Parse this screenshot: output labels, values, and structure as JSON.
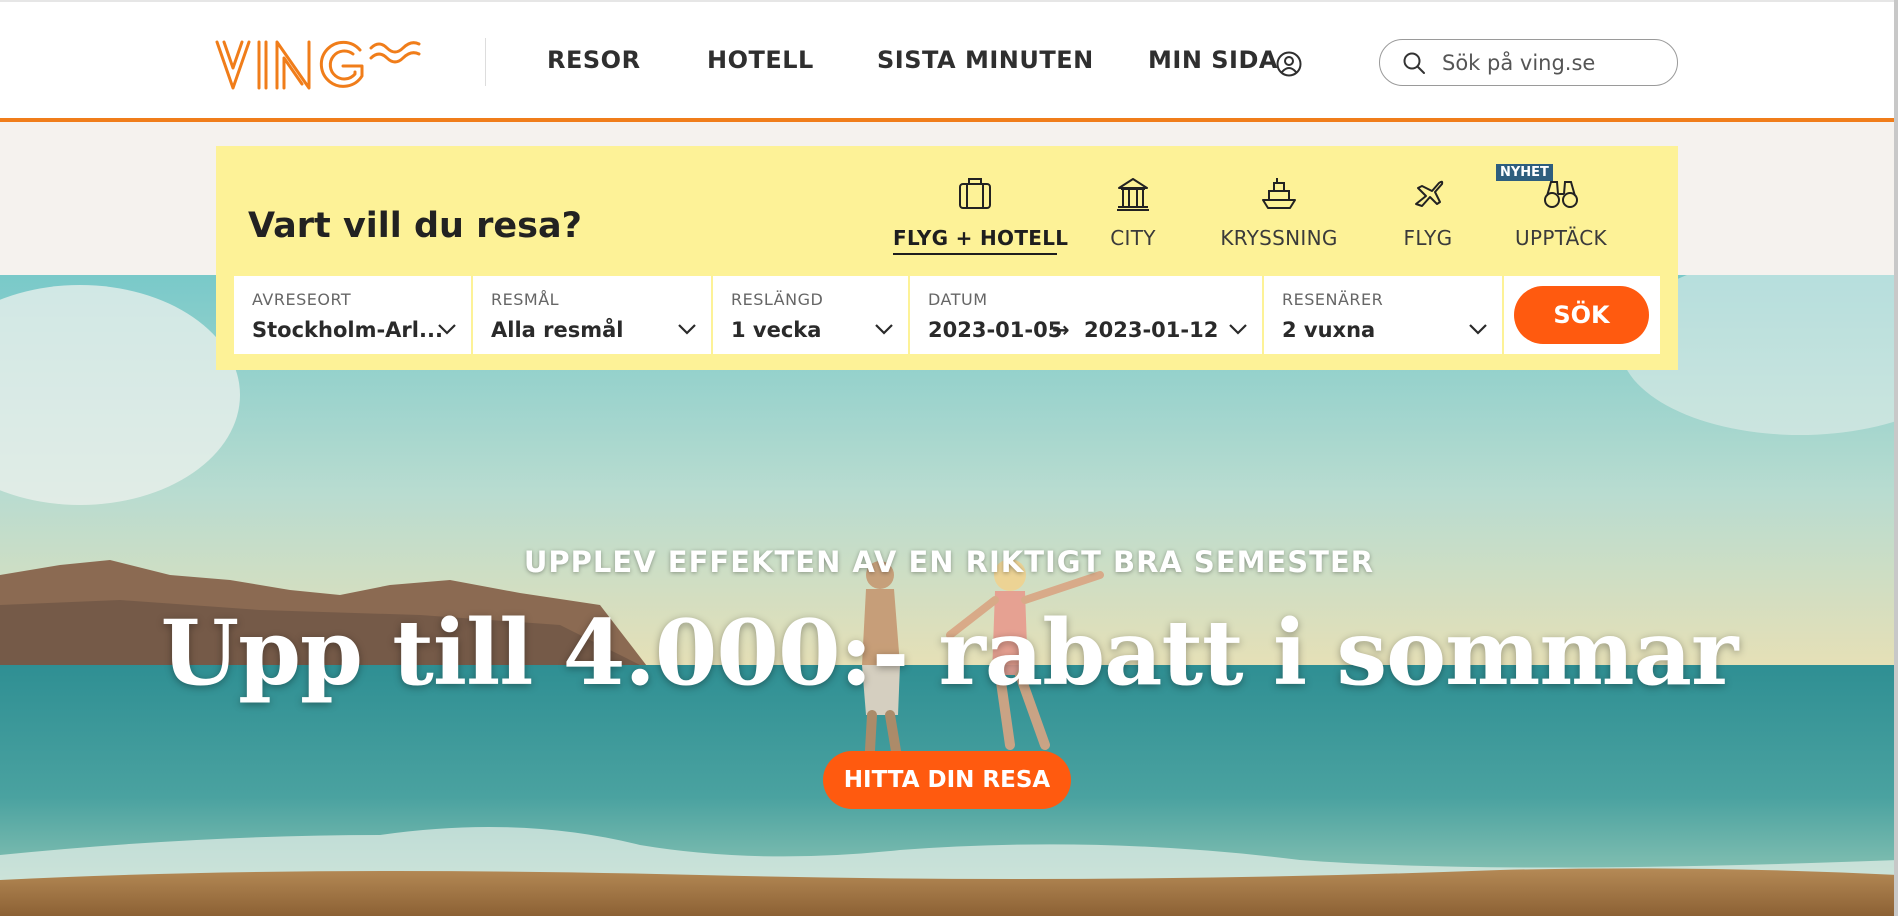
{
  "header": {
    "logo_text": "VING",
    "nav": [
      {
        "label": "RESOR"
      },
      {
        "label": "HOTELL"
      },
      {
        "label": "SISTA MINUTEN"
      },
      {
        "label": "MIN SIDA"
      }
    ],
    "search_placeholder": "Sök på ving.se"
  },
  "search_panel": {
    "title": "Vart vill du resa?",
    "tabs": [
      {
        "label": "FLYG + HOTELL",
        "icon": "suitcase-icon",
        "active": true
      },
      {
        "label": "CITY",
        "icon": "city-building-icon",
        "active": false
      },
      {
        "label": "KRYSSNING",
        "icon": "cruise-ship-icon",
        "active": false
      },
      {
        "label": "FLYG",
        "icon": "airplane-icon",
        "active": false
      },
      {
        "label": "UPPTÄCK",
        "icon": "binoculars-icon",
        "active": false
      }
    ],
    "new_badge": "NYHET",
    "fields": {
      "departure": {
        "label": "AVRESEORT",
        "value": "Stockholm-Arl..."
      },
      "destination": {
        "label": "RESMÅL",
        "value": "Alla resmål"
      },
      "duration": {
        "label": "RESLÄNGD",
        "value": "1 vecka"
      },
      "dates": {
        "label": "DATUM",
        "from": "2023-01-05",
        "arrow": "→",
        "to": "2023-01-12"
      },
      "travelers": {
        "label": "RESENÄRER",
        "value": "2 vuxna"
      }
    },
    "search_button": "SÖK"
  },
  "hero": {
    "subtitle": "UPPLEV EFFEKTEN AV EN RIKTIGT BRA SEMESTER",
    "headline": "Upp till 4.000:- rabatt i sommar",
    "cta": "HITTA DIN RESA"
  },
  "colors": {
    "brand_orange": "#f07d1a",
    "cta_orange": "#ff5a0f",
    "panel_yellow": "#fdf297",
    "badge_blue": "#2e5e7e"
  }
}
